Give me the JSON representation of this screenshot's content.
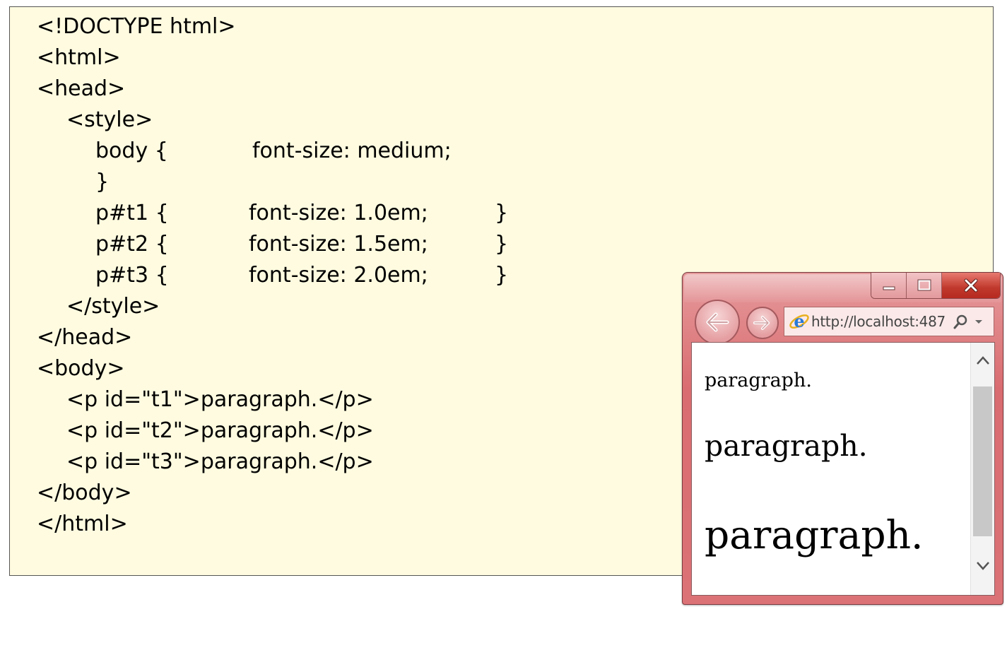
{
  "code_lines": [
    {
      "id": "doctype",
      "segments": [
        "<!DOCTYPE html>"
      ]
    },
    {
      "id": "html-open",
      "segments": [
        "<html>"
      ]
    },
    {
      "id": "head-open",
      "segments": [
        "<head>"
      ]
    },
    {
      "id": "style-open",
      "segments": [
        "<style>"
      ]
    },
    {
      "id": "body-rule",
      "segments": [
        "body {",
        "font-size: medium;"
      ]
    },
    {
      "id": "body-rule-close",
      "segments": [
        "}"
      ]
    },
    {
      "id": "t1-rule",
      "segments": [
        "p#t1 {",
        "font-size: 1.0em;",
        "}"
      ]
    },
    {
      "id": "t2-rule",
      "segments": [
        "p#t2 {",
        "font-size: 1.5em;",
        "}"
      ]
    },
    {
      "id": "t3-rule",
      "segments": [
        "p#t3 {",
        "font-size: 2.0em;",
        "}"
      ]
    },
    {
      "id": "style-close",
      "segments": [
        "</style>"
      ]
    },
    {
      "id": "head-close",
      "segments": [
        "</head>"
      ]
    },
    {
      "id": "body-open",
      "segments": [
        "<body>"
      ]
    },
    {
      "id": "p-t1",
      "segments": [
        "<p id=\"t1\">paragraph.</p>"
      ]
    },
    {
      "id": "p-t2",
      "segments": [
        "<p id=\"t2\">paragraph.</p>"
      ]
    },
    {
      "id": "p-t3",
      "segments": [
        "<p id=\"t3\">paragraph.</p>"
      ]
    },
    {
      "id": "body-close",
      "segments": [
        "</body>"
      ]
    },
    {
      "id": "html-close",
      "segments": [
        "</html>"
      ]
    }
  ],
  "browser": {
    "address_url": "http://localhost:487",
    "paragraphs": [
      "paragraph.",
      "paragraph.",
      "paragraph."
    ],
    "window_buttons": {
      "minimize": "minimize-icon",
      "maximize": "maximize-icon",
      "close": "close-icon"
    },
    "colors": {
      "frame": "#d96c70",
      "close_button": "#c0382c",
      "code_background": "#fefbe0"
    }
  }
}
